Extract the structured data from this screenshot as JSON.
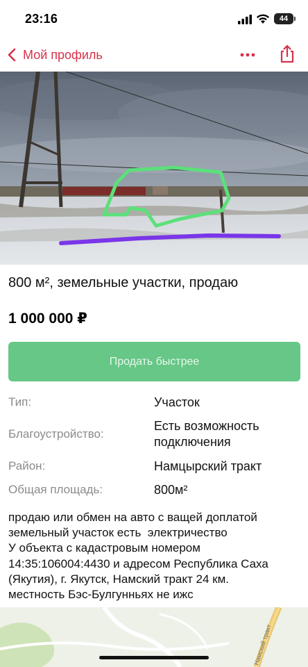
{
  "status_bar": {
    "time": "23:16",
    "battery": "44",
    "icons": [
      "signal-icon",
      "wifi-icon",
      "battery-icon"
    ]
  },
  "nav": {
    "back_label": "Мой профиль",
    "back_icon": "chevron-left-icon",
    "more_icon": "more-dots-icon",
    "share_icon": "share-icon",
    "accent_color": "#d8314b"
  },
  "listing": {
    "title": "800 м², земельные участки, продаю",
    "price": "1 000 000 ₽",
    "sell_faster_label": "Продать быстрее",
    "button_color": "#66c786"
  },
  "params": [
    {
      "key": "Тип:",
      "value": "Участок"
    },
    {
      "key": "Благоустройство:",
      "value": "Есть возможность подключения"
    },
    {
      "key": "Район:",
      "value": "Намцырский тракт"
    },
    {
      "key": "Общая площадь:",
      "value": "800м²"
    }
  ],
  "description": [
    "продаю или обмен на авто с ващей доплатой",
    "земельный участок есть  электричество",
    "У объекта с кадастровым номером",
    "14:35:106004:4430 и адресом Республика Саха",
    "(Якутия), г. Якутск, Намский тракт 24 км.",
    "местность Бэс-Булгунньях не ижс"
  ],
  "map": {
    "road_label": "Намский тракт"
  }
}
